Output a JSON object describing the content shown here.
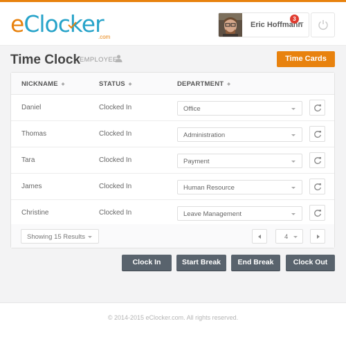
{
  "brand": {
    "logo_e": "e",
    "logo_rest": "Clocker",
    "logo_com": ".com",
    "accent_color": "#e8820e",
    "logo_blue": "#27a3c9"
  },
  "header": {
    "user_name": "Eric Hoffmann",
    "notification_count": "3",
    "icons": {
      "avatar": "user-photo",
      "caret": "chevron-down-icon",
      "power": "power-icon"
    }
  },
  "page": {
    "title": "Time Clock",
    "subtitle": "EMPLOYEE",
    "subtitle_icon": "user-icon",
    "time_cards_label": "Time Cards"
  },
  "table": {
    "columns": [
      {
        "label": "NICKNAME",
        "sortable": true
      },
      {
        "label": "STATUS",
        "sortable": true
      },
      {
        "label": "DEPARTMENT",
        "sortable": true
      }
    ],
    "rows": [
      {
        "nickname": "Daniel",
        "status": "Clocked In",
        "department": "Office"
      },
      {
        "nickname": "Thomas",
        "status": "Clocked In",
        "department": "Administration"
      },
      {
        "nickname": "Tara",
        "status": "Clocked In",
        "department": "Payment"
      },
      {
        "nickname": "James",
        "status": "Clocked In",
        "department": "Human Resource"
      },
      {
        "nickname": "Christine",
        "status": "Clocked In",
        "department": "Leave Management"
      }
    ],
    "row_action_icon": "refresh-icon"
  },
  "pagination": {
    "results_label": "Showing 15 Results",
    "current_page": "4"
  },
  "actions": {
    "clock_in": "Clock In",
    "start_break": "Start Break",
    "end_break": "End Break",
    "clock_out": "Clock Out"
  },
  "footer": {
    "copyright": "© 2014-2015 eClocker.com. All rights reserved."
  }
}
